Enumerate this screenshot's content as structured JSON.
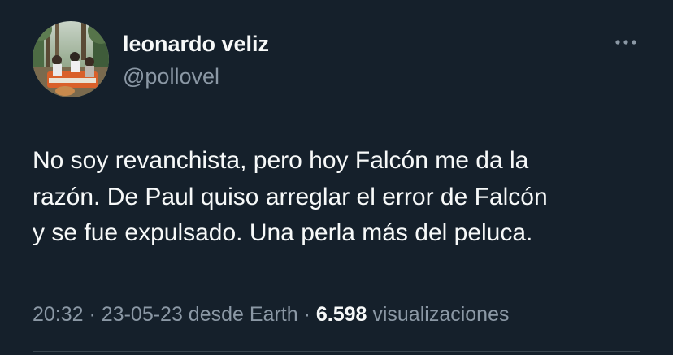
{
  "author": {
    "display_name": "leonardo veliz",
    "handle": "@pollovel",
    "avatar_icon": "profile-photo"
  },
  "tweet": {
    "lines": [
      "No soy revanchista, pero hoy Falcón me da la",
      "razón. De Paul quiso arreglar el error de Falcón",
      "y se fue expulsado. Una perla más del peluca."
    ]
  },
  "meta": {
    "time": "20:32",
    "sep1": " · ",
    "date": "23-05-23",
    "source": " desde Earth",
    "sep2": " · ",
    "views_count": "6.598",
    "views_label": " visualizaciones"
  },
  "colors": {
    "background": "#15202b",
    "primary_text": "#f7f9f9",
    "secondary_text": "#8b98a5",
    "divider": "#38444d"
  }
}
